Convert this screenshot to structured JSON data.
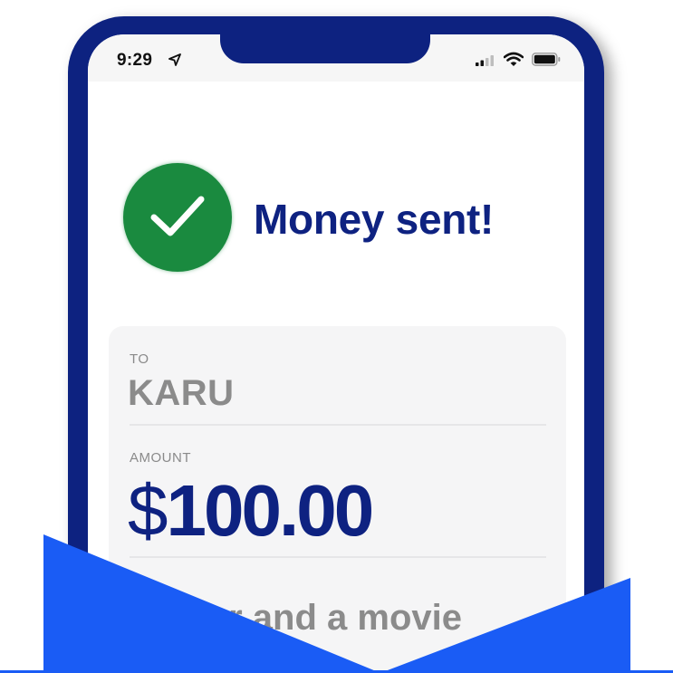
{
  "status_bar": {
    "time": "9:29",
    "location_icon": "location-arrow-icon",
    "signal_icon": "cellular-signal-icon",
    "wifi_icon": "wifi-icon",
    "battery_icon": "battery-icon"
  },
  "confirmation": {
    "icon": "checkmark-icon",
    "title": "Money sent!"
  },
  "details": {
    "to_label": "TO",
    "to_value": "KARU",
    "amount_label": "AMOUNT",
    "amount_currency": "$",
    "amount_number": "100.00",
    "note": "Dinner and a movie"
  },
  "colors": {
    "frame": "#0d2280",
    "brand_text": "#0e2281",
    "success": "#1a8a3f",
    "banner": "#1a5cf5",
    "card": "#f5f5f6",
    "muted_text": "#8b8b8b"
  }
}
